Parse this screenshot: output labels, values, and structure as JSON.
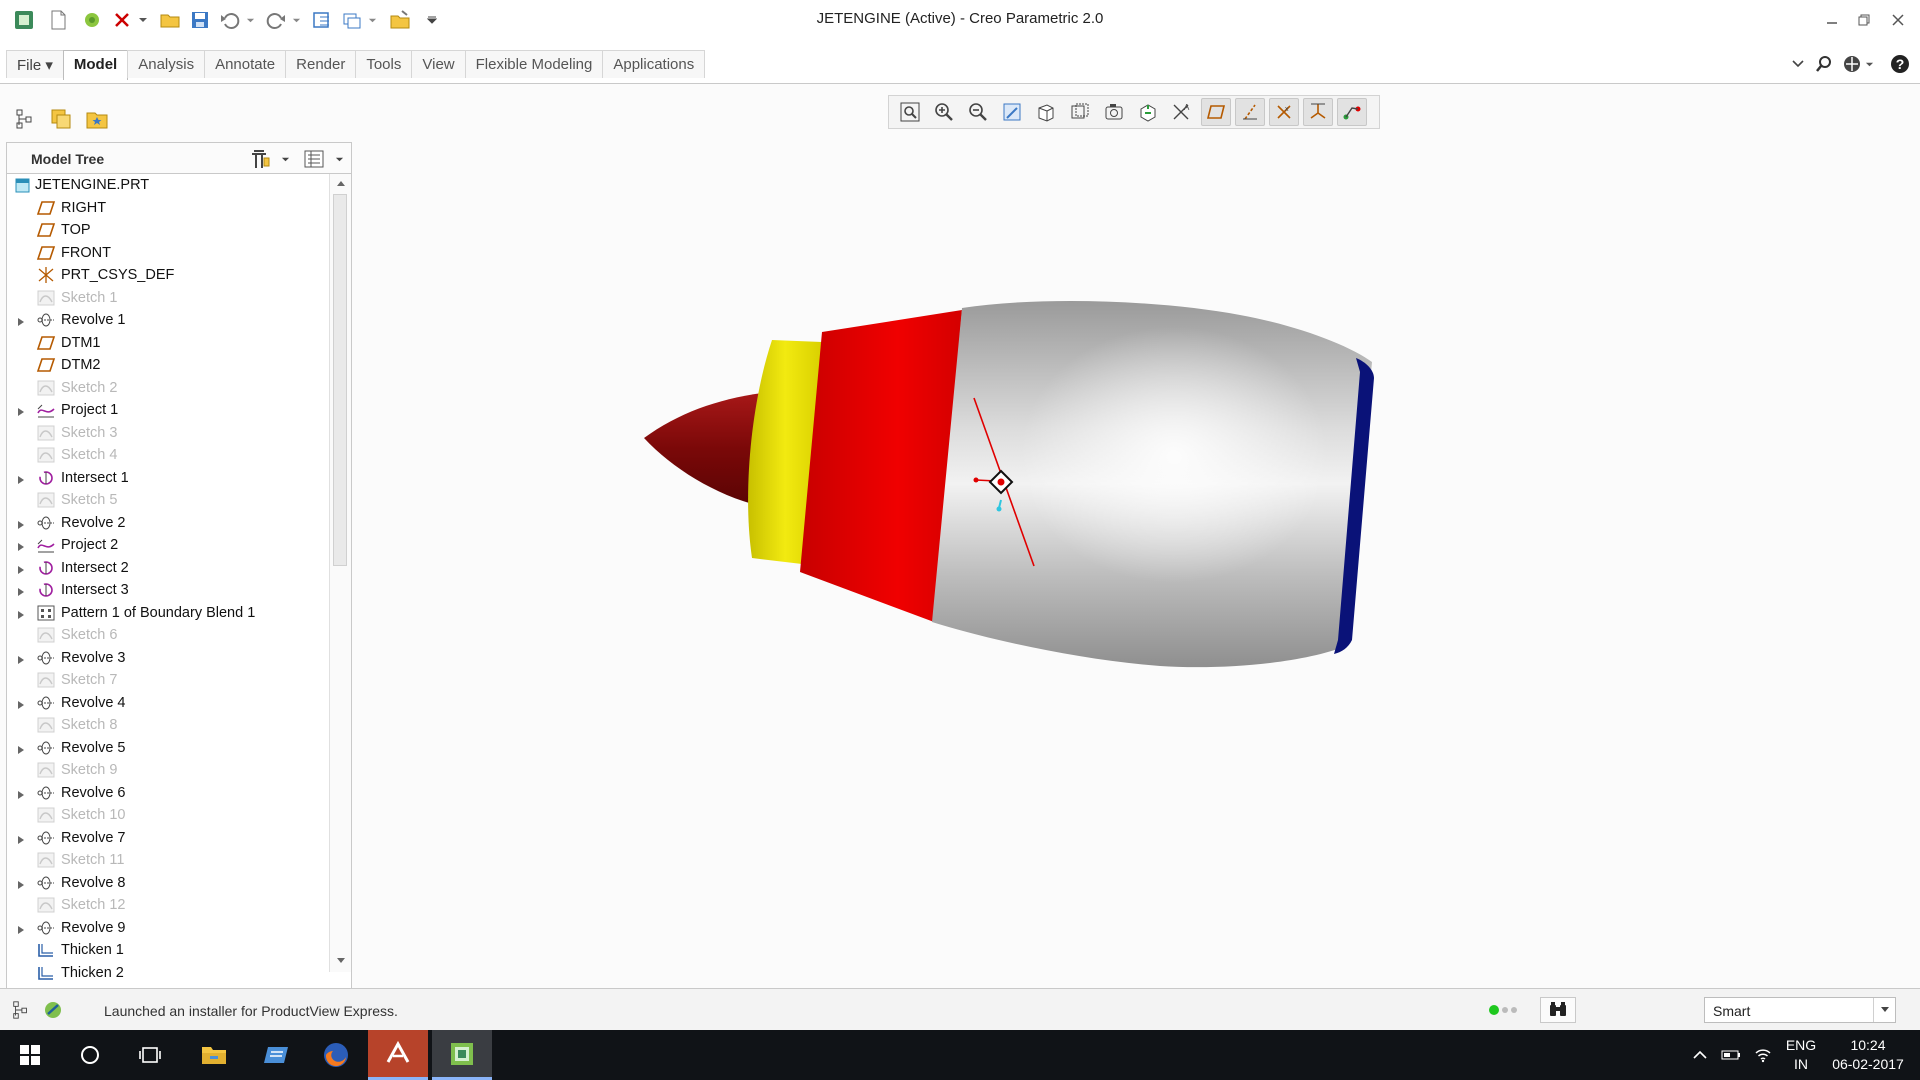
{
  "window": {
    "title": "JETENGINE (Active) - Creo Parametric 2.0"
  },
  "ribbon": {
    "tabs": [
      {
        "label": "File ▾",
        "id": "file"
      },
      {
        "label": "Model",
        "id": "model",
        "active": true
      },
      {
        "label": "Analysis",
        "id": "analysis"
      },
      {
        "label": "Annotate",
        "id": "annotate"
      },
      {
        "label": "Render",
        "id": "render"
      },
      {
        "label": "Tools",
        "id": "tools"
      },
      {
        "label": "View",
        "id": "view"
      },
      {
        "label": "Flexible Modeling",
        "id": "flexible-modeling"
      },
      {
        "label": "Applications",
        "id": "applications"
      }
    ]
  },
  "model_tree": {
    "title": "Model Tree",
    "items": [
      {
        "label": "JETENGINE.PRT",
        "icon": "part-icon",
        "root": true
      },
      {
        "label": "RIGHT",
        "icon": "datum-plane-icon"
      },
      {
        "label": "TOP",
        "icon": "datum-plane-icon"
      },
      {
        "label": "FRONT",
        "icon": "datum-plane-icon"
      },
      {
        "label": "PRT_CSYS_DEF",
        "icon": "csys-icon"
      },
      {
        "label": "Sketch 1",
        "icon": "sketch-icon",
        "suppressed": true
      },
      {
        "label": "Revolve 1",
        "icon": "revolve-icon",
        "expandable": true
      },
      {
        "label": "DTM1",
        "icon": "datum-plane-icon"
      },
      {
        "label": "DTM2",
        "icon": "datum-plane-icon"
      },
      {
        "label": "Sketch 2",
        "icon": "sketch-icon",
        "suppressed": true
      },
      {
        "label": "Project 1",
        "icon": "project-icon",
        "expandable": true
      },
      {
        "label": "Sketch 3",
        "icon": "sketch-icon",
        "suppressed": true
      },
      {
        "label": "Sketch 4",
        "icon": "sketch-icon",
        "suppressed": true
      },
      {
        "label": "Intersect 1",
        "icon": "intersect-icon",
        "expandable": true
      },
      {
        "label": "Sketch 5",
        "icon": "sketch-icon",
        "suppressed": true
      },
      {
        "label": "Revolve 2",
        "icon": "revolve-icon",
        "expandable": true
      },
      {
        "label": "Project 2",
        "icon": "project-icon",
        "expandable": true
      },
      {
        "label": "Intersect 2",
        "icon": "intersect-icon",
        "expandable": true
      },
      {
        "label": "Intersect 3",
        "icon": "intersect-icon",
        "expandable": true
      },
      {
        "label": "Pattern 1 of Boundary Blend 1",
        "icon": "pattern-icon",
        "expandable": true
      },
      {
        "label": "Sketch 6",
        "icon": "sketch-icon",
        "suppressed": true
      },
      {
        "label": "Revolve 3",
        "icon": "revolve-icon",
        "expandable": true
      },
      {
        "label": "Sketch 7",
        "icon": "sketch-icon",
        "suppressed": true
      },
      {
        "label": "Revolve 4",
        "icon": "revolve-icon",
        "expandable": true
      },
      {
        "label": "Sketch 8",
        "icon": "sketch-icon",
        "suppressed": true
      },
      {
        "label": "Revolve 5",
        "icon": "revolve-icon",
        "expandable": true
      },
      {
        "label": "Sketch 9",
        "icon": "sketch-icon",
        "suppressed": true
      },
      {
        "label": "Revolve 6",
        "icon": "revolve-icon",
        "expandable": true
      },
      {
        "label": "Sketch 10",
        "icon": "sketch-icon",
        "suppressed": true
      },
      {
        "label": "Revolve 7",
        "icon": "revolve-icon",
        "expandable": true
      },
      {
        "label": "Sketch 11",
        "icon": "sketch-icon",
        "suppressed": true
      },
      {
        "label": "Revolve 8",
        "icon": "revolve-icon",
        "expandable": true
      },
      {
        "label": "Sketch 12",
        "icon": "sketch-icon",
        "suppressed": true
      },
      {
        "label": "Revolve 9",
        "icon": "revolve-icon",
        "expandable": true
      },
      {
        "label": "Thicken 1",
        "icon": "thicken-icon"
      },
      {
        "label": "Thicken 2",
        "icon": "thicken-icon"
      }
    ]
  },
  "graphics_toolbar": {
    "buttons": [
      "refit-icon",
      "zoom-in-icon",
      "zoom-out-icon",
      "repaint-icon",
      "display-style-icon",
      "saved-orientations-icon",
      "named-views-icon",
      "spin-center-icon",
      "annotation-display-icon",
      "plane-display-icon",
      "axis-display-icon",
      "point-display-icon",
      "csys-display-icon",
      "appearance-display-icon"
    ],
    "active": [
      "plane-display-icon",
      "axis-display-icon",
      "point-display-icon",
      "csys-display-icon",
      "appearance-display-icon"
    ]
  },
  "model_colors": {
    "nose_cone": "#8b0d0d",
    "yellow_ring": "#e4dc00",
    "red_ring": "#e00000",
    "nacelle": "#bcbcbc",
    "rear_ring": "#0a1278",
    "csys_marker": "#e00000"
  },
  "status": {
    "message": "Launched an installer for ProductView Express.",
    "filter": "Smart"
  },
  "taskbar": {
    "apps": [
      "windows-start-icon",
      "cortana-icon",
      "task-view-icon",
      "file-explorer-icon",
      "app-icon",
      "firefox-icon",
      "autodesk-icon",
      "creo-icon"
    ],
    "language_line1": "ENG",
    "language_line2": "IN",
    "time": "10:24",
    "date": "06-02-2017"
  }
}
